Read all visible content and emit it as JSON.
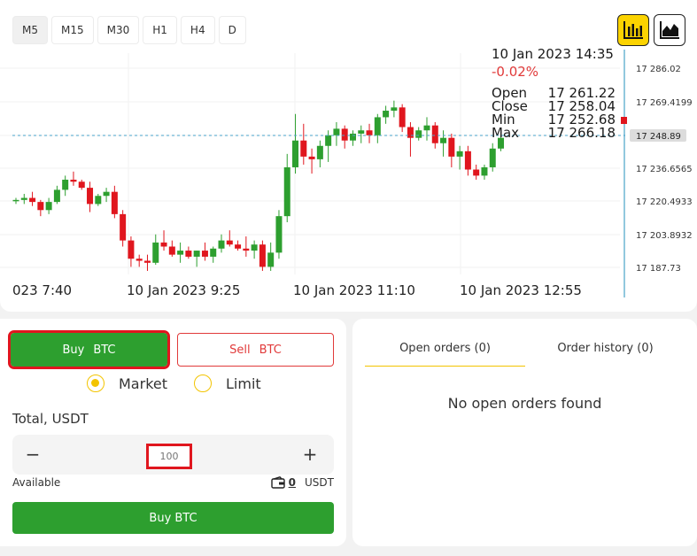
{
  "timeframes": [
    "M5",
    "M15",
    "M30",
    "H1",
    "H4",
    "D"
  ],
  "active_timeframe": "M5",
  "chart_type_buttons": {
    "candle_icon": "bar-chart-icon",
    "area_icon": "area-chart-icon",
    "active": "candle"
  },
  "tooltip": {
    "datetime": "10 Jan 2023 14:35",
    "change": "-0.02%",
    "open_label": "Open",
    "open": "17 261.22",
    "close_label": "Close",
    "close": "17 258.04",
    "min_label": "Min",
    "min": "17 252.68",
    "max_label": "Max",
    "max": "17 266.18"
  },
  "y_axis_labels": [
    "17 286.02",
    "17 269.4199",
    "17 248.89",
    "17 236.6565",
    "17 220.4933",
    "17 203.8932",
    "17 187.73"
  ],
  "current_price_label": "17 248.89",
  "x_axis_labels": [
    "023 7:40",
    "10 Jan 2023 9:25",
    "10 Jan 2023 11:10",
    "10 Jan 2023 12:55"
  ],
  "colors": {
    "up": "#2d9f2f",
    "down": "#e0161e",
    "accent": "#fbd300",
    "price_line": "#4aa3c9"
  },
  "chart_data": {
    "type": "candlestick",
    "ylim": [
      17183,
      17292
    ],
    "candles": [
      [
        17221,
        17222,
        17219,
        17221
      ],
      [
        17221,
        17224,
        17219,
        17222
      ],
      [
        17222,
        17225,
        17218,
        17220
      ],
      [
        17220,
        17221,
        17213,
        17216
      ],
      [
        17216,
        17222,
        17214,
        17220
      ],
      [
        17220,
        17228,
        17219,
        17226
      ],
      [
        17226,
        17233,
        17223,
        17231
      ],
      [
        17231,
        17235,
        17228,
        17230
      ],
      [
        17230,
        17231,
        17226,
        17227
      ],
      [
        17227,
        17230,
        17215,
        17219
      ],
      [
        17219,
        17224,
        17218,
        17223
      ],
      [
        17223,
        17227,
        17220,
        17225
      ],
      [
        17225,
        17228,
        17212,
        17214
      ],
      [
        17214,
        17216,
        17198,
        17201
      ],
      [
        17201,
        17203,
        17188,
        17192
      ],
      [
        17192,
        17194,
        17188,
        17191
      ],
      [
        17191,
        17194,
        17186,
        17190
      ],
      [
        17190,
        17204,
        17189,
        17200
      ],
      [
        17200,
        17206,
        17196,
        17198
      ],
      [
        17198,
        17201,
        17193,
        17194
      ],
      [
        17194,
        17200,
        17190,
        17196
      ],
      [
        17196,
        17198,
        17192,
        17193
      ],
      [
        17193,
        17196,
        17188,
        17196
      ],
      [
        17196,
        17200,
        17191,
        17193
      ],
      [
        17193,
        17198,
        17190,
        17197
      ],
      [
        17197,
        17204,
        17195,
        17201
      ],
      [
        17201,
        17206,
        17198,
        17199
      ],
      [
        17199,
        17201,
        17196,
        17197
      ],
      [
        17197,
        17203,
        17193,
        17196
      ],
      [
        17196,
        17201,
        17192,
        17199
      ],
      [
        17199,
        17201,
        17186,
        17188
      ],
      [
        17188,
        17200,
        17186,
        17195
      ],
      [
        17195,
        17216,
        17192,
        17213
      ],
      [
        17213,
        17242,
        17210,
        17237
      ],
      [
        17237,
        17262,
        17234,
        17247
      ],
      [
        17247,
        17256,
        17238,
        17241
      ],
      [
        17241,
        17244,
        17234,
        17240
      ],
      [
        17240,
        17247,
        17237,
        17245
      ],
      [
        17245,
        17252,
        17239,
        17249
      ],
      [
        17249,
        17257,
        17245,
        17253
      ],
      [
        17253,
        17255,
        17244,
        17247
      ],
      [
        17247,
        17252,
        17245,
        17250
      ],
      [
        17250,
        17255,
        17246,
        17252
      ],
      [
        17252,
        17256,
        17246,
        17249
      ],
      [
        17249,
        17262,
        17246,
        17260
      ],
      [
        17260,
        17267,
        17256,
        17264
      ],
      [
        17264,
        17270,
        17260,
        17266
      ],
      [
        17266,
        17268,
        17251,
        17254
      ],
      [
        17254,
        17257,
        17241,
        17248
      ],
      [
        17248,
        17254,
        17247,
        17252
      ],
      [
        17252,
        17260,
        17247,
        17255
      ],
      [
        17255,
        17257,
        17244,
        17246
      ],
      [
        17246,
        17252,
        17241,
        17248
      ],
      [
        17248,
        17250,
        17237,
        17241
      ],
      [
        17241,
        17245,
        17236,
        17243
      ],
      [
        17243,
        17245,
        17233,
        17236
      ],
      [
        17236,
        17238,
        17231,
        17233
      ],
      [
        17233,
        17238,
        17231,
        17237
      ],
      [
        17237,
        17246,
        17235,
        17244
      ],
      [
        17244,
        17249,
        17243,
        17248
      ]
    ]
  },
  "trade": {
    "buy_tab": "Buy",
    "buy_tab_asset": "BTC",
    "sell_tab": "Sell",
    "sell_tab_asset": "BTC",
    "order_type_market": "Market",
    "order_type_limit": "Limit",
    "selected_order_type": "Market",
    "total_label": "Total, USDT",
    "minus": "−",
    "plus": "+",
    "amount_placeholder": "100",
    "available_label": "Available",
    "available_amount": "0",
    "available_currency": "USDT",
    "submit_label": "Buy BTC"
  },
  "orders": {
    "tab_open": "Open orders (0)",
    "tab_history": "Order history (0)",
    "active_tab": "open",
    "empty_message": "No open orders found"
  }
}
